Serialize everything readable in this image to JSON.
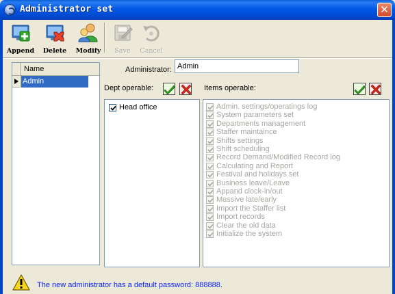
{
  "window": {
    "title": "Administrator set",
    "close_glyph": "✕"
  },
  "toolbar": {
    "append": {
      "label": "Append",
      "icon": "add-user-icon",
      "enabled": true
    },
    "delete": {
      "label": "Delete",
      "icon": "delete-user-icon",
      "enabled": true
    },
    "modify": {
      "label": "Modify",
      "icon": "modify-user-icon",
      "enabled": true
    },
    "save": {
      "label": "Save",
      "icon": "save-icon",
      "enabled": false
    },
    "cancel": {
      "label": "Cancel",
      "icon": "cancel-icon",
      "enabled": false
    }
  },
  "name_list": {
    "header": "Name",
    "rows": [
      "Admin"
    ],
    "selected": "Admin"
  },
  "administrator": {
    "label": "Administrator:",
    "value": "Admin"
  },
  "dept": {
    "label": "Dept operable:",
    "items": [
      {
        "label": "Head office",
        "checked": true,
        "enabled": true
      }
    ]
  },
  "items": {
    "label": "Items operable:",
    "list": [
      {
        "label": "Admin. settings/operatings log",
        "checked": true,
        "enabled": false
      },
      {
        "label": "System parameters set",
        "checked": true,
        "enabled": false
      },
      {
        "label": "Departments management",
        "checked": true,
        "enabled": false
      },
      {
        "label": "Staffer maintaince",
        "checked": true,
        "enabled": false
      },
      {
        "label": "Shifts settings",
        "checked": true,
        "enabled": false
      },
      {
        "label": "Shift scheduling",
        "checked": true,
        "enabled": false
      },
      {
        "label": "Record Demand/Modified Record log",
        "checked": true,
        "enabled": false
      },
      {
        "label": "Calculating and Report",
        "checked": true,
        "enabled": false
      },
      {
        "label": "Festival and holidays set",
        "checked": true,
        "enabled": false
      },
      {
        "label": "Business leave/Leave",
        "checked": true,
        "enabled": false
      },
      {
        "label": "Appand clock-in/out",
        "checked": true,
        "enabled": false
      },
      {
        "label": "Massive late/early",
        "checked": true,
        "enabled": false
      },
      {
        "label": "Import the Staffer list",
        "checked": true,
        "enabled": false
      },
      {
        "label": "Import records",
        "checked": true,
        "enabled": false
      },
      {
        "label": "Clear the old data",
        "checked": true,
        "enabled": false
      },
      {
        "label": "Initialize the system",
        "checked": true,
        "enabled": false
      }
    ]
  },
  "status": {
    "icon": "warning-icon",
    "message": "The new administrator has a default password: 888888."
  },
  "colors": {
    "title_bar": "#0058e6",
    "selection": "#316ac5",
    "status_text": "#0b24fb",
    "disabled_text": "#a6a5a0"
  }
}
